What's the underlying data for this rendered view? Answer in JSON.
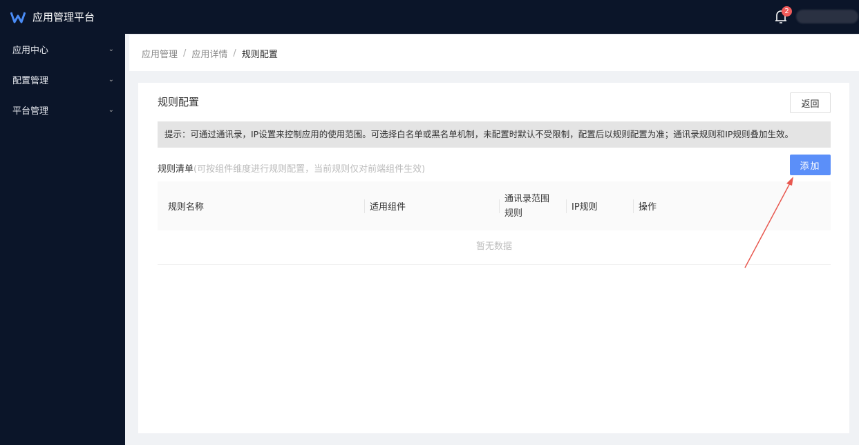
{
  "header": {
    "title": "应用管理平台",
    "notification_count": "2",
    "brand_color": "#4a8cf7"
  },
  "sidebar": {
    "items": [
      {
        "label": "应用中心"
      },
      {
        "label": "配置管理"
      },
      {
        "label": "平台管理"
      }
    ]
  },
  "breadcrumb": [
    "应用管理",
    "应用详情",
    "规则配置"
  ],
  "page": {
    "title": "规则配置",
    "back_label": "返回",
    "tip": "提示：可通过通讯录，IP设置来控制应用的使用范围。可选择白名单或黑名单机制，未配置时默认不受限制，配置后以规则配置为准；通讯录规则和IP规则叠加生效。",
    "list_title": "规则清单",
    "list_hint": "(可按组件维度进行规则配置，当前规则仅对前端组件生效)",
    "add_label": "添加"
  },
  "table": {
    "columns": [
      "规则名称",
      "适用组件",
      "通讯录范围规则",
      "IP规则",
      "操作"
    ],
    "empty": "暂无数据"
  }
}
